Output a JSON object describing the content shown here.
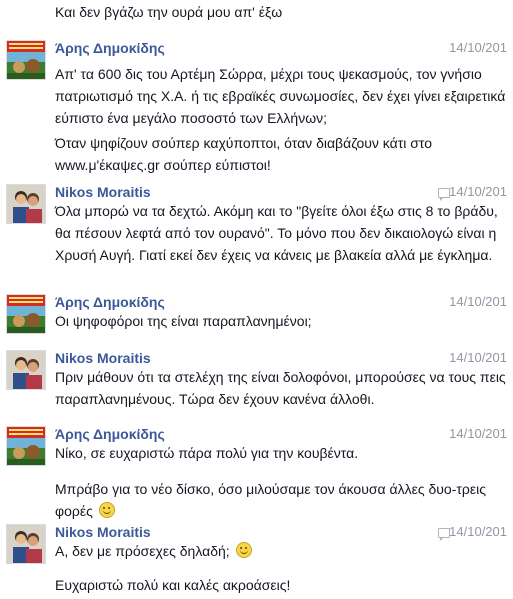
{
  "top_line": "Και δεν βγάζω την ουρά μου απ' έξω",
  "messages": [
    {
      "author": "Άρης Δημοκίδης",
      "time": "14/10/201",
      "avatar": "poster",
      "paragraphs": [
        "Απ' τα 600 δις του Αρτέμη Σώρρα, μέχρι τους ψεκασμούς, τον γνήσιο πατριωτισμό της Χ.Α. ή τις εβραϊκές συνωμοσίες, δεν έχει γίνει εξαιρετικά εύπιστο ένα μεγάλο ποσοστό των Ελλήνων;",
        "Όταν ψηφίζουν σούπερ καχύποπτοι, όταν διαβάζουν κάτι στο www.μ'έκαψες.gr σούπερ εύπιστοι!"
      ]
    },
    {
      "author": "Nikos Moraitis",
      "time": "14/10/201",
      "avatar": "person",
      "paragraphs": [
        "Όλα μπορώ να τα δεχτώ. Ακόμη και το \"βγείτε όλοι έξω στις 8 το βράδυ, θα πέσουν λεφτά από τον ουρανό\". Το μόνο που δεν δικαιολογώ είναι η Χρυσή Αυγή. Γιατί εκεί δεν έχεις να κάνεις με βλακεία αλλά με έγκλημα."
      ]
    },
    {
      "author": "Άρης Δημοκίδης",
      "time": "14/10/201",
      "avatar": "poster",
      "paragraphs": [
        "Οι ψηφοφόροι της είναι παραπλανημένοι;"
      ]
    },
    {
      "author": "Nikos Moraitis",
      "time": "14/10/201",
      "avatar": "person",
      "paragraphs": [
        "Πριν μάθουν ότι τα στελέχη της είναι δολοφόνοι, μπορούσες να τους πεις παραπλανημένους. Τώρα δεν έχουν κανένα άλλοθι."
      ]
    },
    {
      "author": "Άρης Δημοκίδης",
      "time": "14/10/201",
      "avatar": "poster",
      "paragraphs": [
        "Νίκο, σε ευχαριστώ πάρα πολύ για την κουβέντα.",
        "Μπράβο για το νέο δίσκο, όσο μιλούσαμε τον άκουσα άλλες δυο-τρεις φορές"
      ]
    },
    {
      "author": "Nikos Moraitis",
      "time": "14/10/201",
      "avatar": "person",
      "paragraphs": [
        "Α, δεν με πρόσεχες δηλαδή;",
        "Ευχαριστώ πολύ και καλές ακροάσεις!"
      ]
    }
  ]
}
